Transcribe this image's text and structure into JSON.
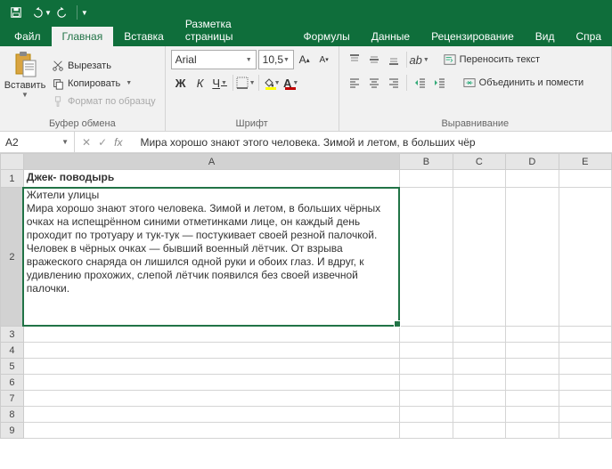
{
  "qat": {
    "save": "save-icon",
    "undo": "undo-icon",
    "redo": "redo-icon"
  },
  "tabs": {
    "file": "Файл",
    "items": [
      "Главная",
      "Вставка",
      "Разметка страницы",
      "Формулы",
      "Данные",
      "Рецензирование",
      "Вид",
      "Спра"
    ],
    "active_index": 0
  },
  "ribbon": {
    "clipboard": {
      "paste": "Вставить",
      "cut": "Вырезать",
      "copy": "Копировать",
      "format_painter": "Формат по образцу",
      "group_label": "Буфер обмена"
    },
    "font": {
      "name": "Arial",
      "size": "10,5",
      "group_label": "Шрифт",
      "bold": "Ж",
      "italic": "К",
      "underline": "Ч",
      "fill_color": "#ffff00",
      "font_color": "#c00000"
    },
    "alignment": {
      "wrap": "Переносить текст",
      "merge": "Объединить и помести",
      "group_label": "Выравнивание"
    }
  },
  "namebox": "A2",
  "formula": "Мира хорошо знают этого человека. Зимой и летом, в больших чёр",
  "columns": [
    "A",
    "B",
    "C",
    "D",
    "E"
  ],
  "rows": [
    "1",
    "2",
    "3",
    "4",
    "5",
    "6",
    "7",
    "8",
    "9"
  ],
  "cells": {
    "A1": "Джек- поводырь",
    "A2": "Жители улицы\nМира хорошо знают этого человека. Зимой и летом, в больших чёрных очках на испещрённом синими отметинками лице, он каждый день проходит по тротуару и тук-тук — постукивает своей резной палочкой. Человек в чёрных очках — бывший военный лётчик. От взрыва вражеского снаряда он лишился одной руки и обоих глаз. И вдруг, к удивлению прохожих, слепой лётчик появился без своей извечной палочки."
  }
}
